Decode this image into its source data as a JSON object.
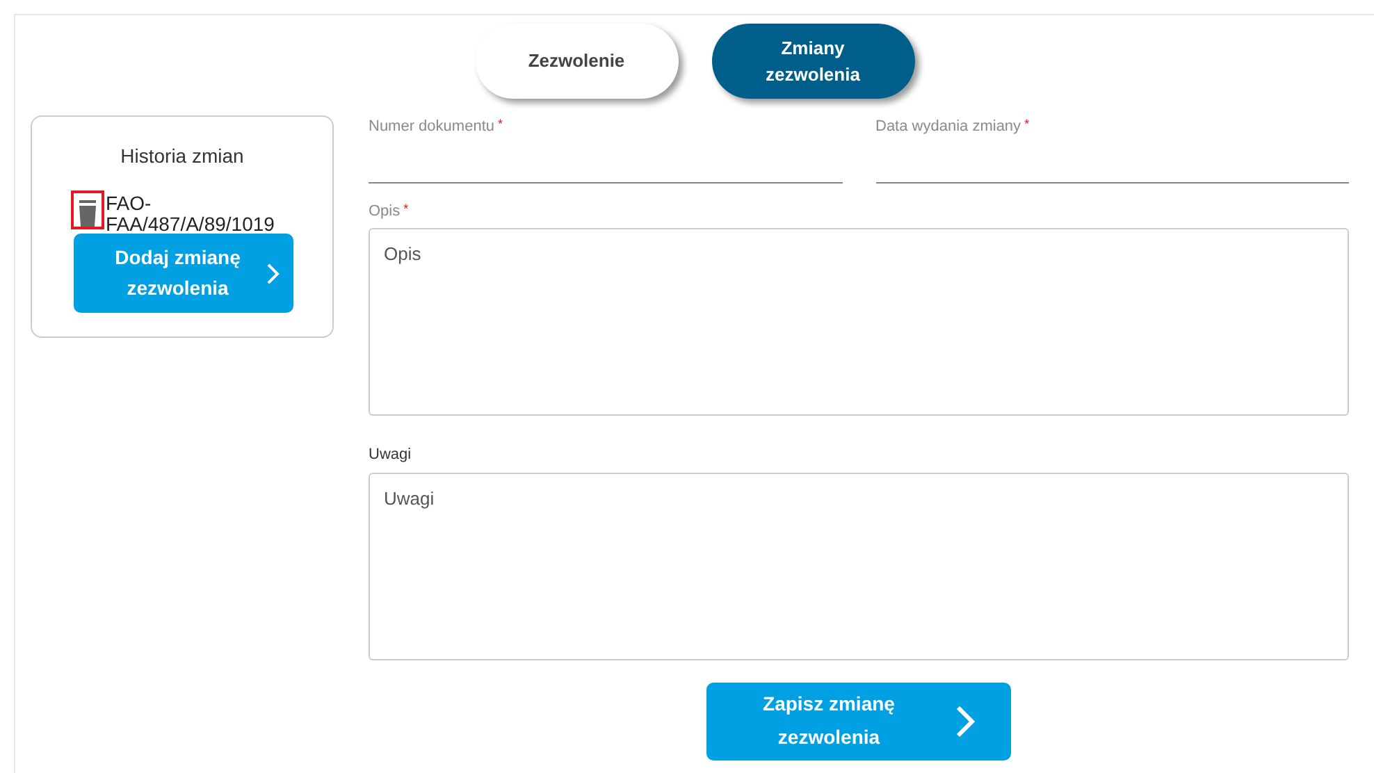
{
  "tabs": [
    {
      "label": "Zezwolenie",
      "selected": false
    },
    {
      "label": "Zmiany zezwolenia",
      "selected": true
    }
  ],
  "history": {
    "title": "Historia zmian",
    "items": [
      {
        "number": "FAO-FAA/487/A/89/1019",
        "highlighted": true
      }
    ],
    "add_button": "Dodaj zmianę zezwolenia"
  },
  "fields": [
    {
      "kind": "line",
      "label": "Numer dokumentu",
      "required_mark": "*"
    },
    {
      "kind": "line",
      "label": "Data wydania zmiany",
      "required_mark": "*"
    },
    {
      "kind": "area",
      "label": "Opis",
      "required_mark": "*",
      "placeholder": "Opis"
    },
    {
      "kind": "area",
      "label": "Uwagi",
      "placeholder": "Uwagi"
    }
  ],
  "save_button": "Zapisz zmianę zezwolenia"
}
